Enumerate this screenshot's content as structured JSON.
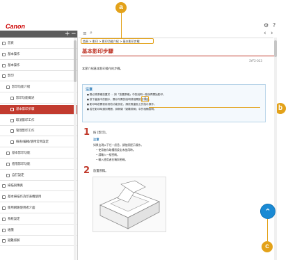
{
  "header": {
    "logo": "Canon",
    "settings_icon": "gear-icon",
    "help_icon": "help-icon"
  },
  "sidebar": {
    "head_plus": "+",
    "head_minus": "−",
    "items": [
      {
        "label": "首頁",
        "indent": 0,
        "selected": false
      },
      {
        "label": "基本操作",
        "indent": 0,
        "selected": false
      },
      {
        "label": "基本操作",
        "indent": 0,
        "selected": false
      },
      {
        "label": "影印",
        "indent": 0,
        "selected": false
      },
      {
        "label": "影印功能介紹",
        "indent": 1,
        "selected": false
      },
      {
        "label": "影印功能概述",
        "indent": 2,
        "selected": false
      },
      {
        "label": "基本影印步驟",
        "indent": 2,
        "selected": true
      },
      {
        "label": "取消影印工作",
        "indent": 2,
        "selected": false
      },
      {
        "label": "管理影印工作",
        "indent": 2,
        "selected": false
      },
      {
        "label": "檢查/編輯/使用常用設定",
        "indent": 2,
        "selected": false
      },
      {
        "label": "基本影印功能",
        "indent": 1,
        "selected": false
      },
      {
        "label": "進階影印功能",
        "indent": 1,
        "selected": false
      },
      {
        "label": "自訂設定",
        "indent": 1,
        "selected": false
      },
      {
        "label": "掃描與傳真",
        "indent": 0,
        "selected": false
      },
      {
        "label": "基本掃描作為印表機使用",
        "indent": 0,
        "selected": false
      },
      {
        "label": "使用網路使用者介面",
        "indent": 0,
        "selected": false
      },
      {
        "label": "系統設定",
        "indent": 0,
        "selected": false
      },
      {
        "label": "維護",
        "indent": 0,
        "selected": false
      },
      {
        "label": "疑難排解",
        "indent": 0,
        "selected": false
      }
    ]
  },
  "toolbar": {
    "view_icon": "≡",
    "search_icon": "⌕",
    "prev": "‹",
    "next": "›"
  },
  "breadcrumb": "首頁 > 影印 > 影印功能介紹 > 基本影印步驟",
  "page": {
    "title": "基本影印步驟",
    "doc_id": "3YF2-013",
    "intro": "本節介紹基本影印操作的步驟。"
  },
  "notice": {
    "label": "注意",
    "lines": [
      "務必將原稿放置於 ... 與「放置原稿」中的說明一致後再開始影印。",
      "按下畫面中的圖示，顯示所需的說明或相關設定項目。",
      "影印時若需使用其他功能設定，請依照畫面上的指示操作。",
      "若在影印時遇到問題，請參閱「疑難排解」中的相關說明。"
    ],
    "hl_icon": "?"
  },
  "steps": [
    {
      "num": "1",
      "text": "按 [影印]。"
    },
    {
      "num": "2",
      "text": "放置原稿。"
    }
  ],
  "step1_note": {
    "label": "注意",
    "intro": "如果出現以下任一訊息，請依照提示操作。",
    "lines": [
      "• 使用者存取權限設定未啟用時。",
      "• 請輸入一組密碼。",
      "• 輸入使用者名稱與密碼。"
    ]
  },
  "totop": "⌃",
  "callouts": [
    "a",
    "b",
    "c"
  ]
}
